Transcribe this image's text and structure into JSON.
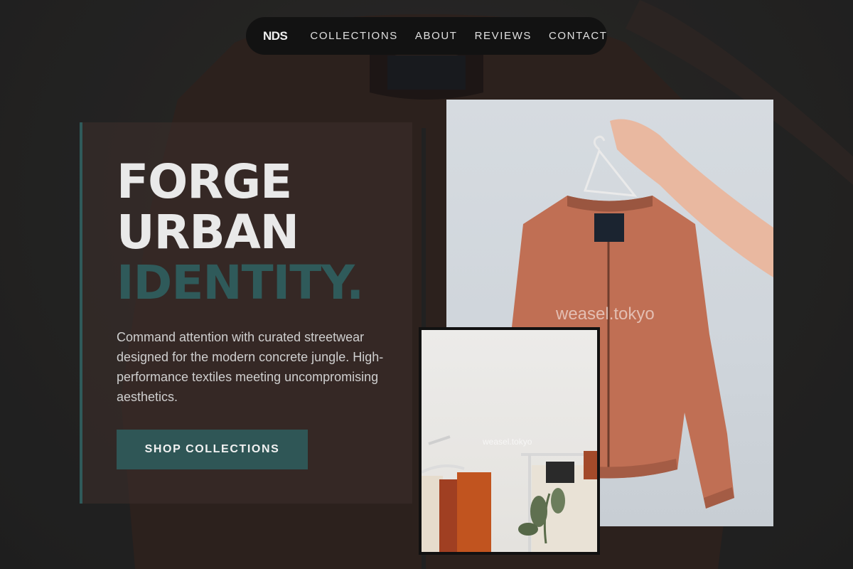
{
  "nav": {
    "logo": "NDS",
    "links": [
      "COLLECTIONS",
      "ABOUT",
      "REVIEWS",
      "CONTACT"
    ]
  },
  "hero": {
    "headline": [
      "FORGE",
      "URBAN",
      "IDENTITY."
    ],
    "description": "Command attention with curated streetwear designed for the modern concrete jungle. High-performance textiles meeting uncompromising aesthetics.",
    "cta_label": "SHOP COLLECTIONS"
  },
  "images": {
    "main_watermark": "weasel.tokyo",
    "secondary_watermark": "weasel.tokyo"
  },
  "colors": {
    "accent": "#2f5656",
    "nav_bg": "#121212",
    "jacket": "#c06f54"
  }
}
